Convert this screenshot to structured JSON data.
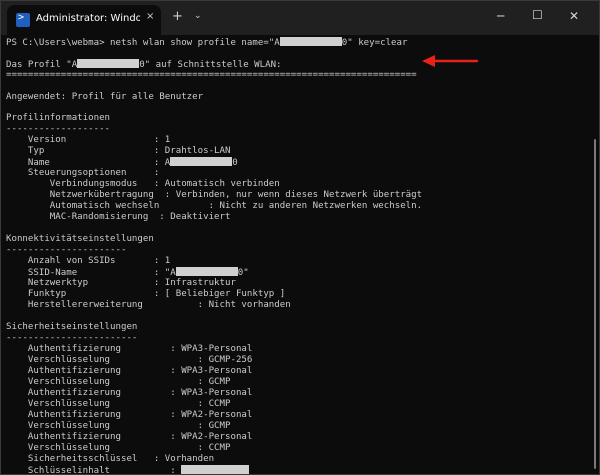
{
  "titlebar": {
    "tab_title": "Administrator: Windows PowerShell",
    "tab_icon": "powershell-icon",
    "tab_close": "×",
    "new_tab": "+",
    "dropdown": "⌄",
    "minimize": "─",
    "maximize": "☐",
    "close": "✕"
  },
  "terminal": {
    "prompt": "PS C:\\Users\\webma> ",
    "command": "netsh wlan show profile name=\"A",
    "command_end": "0\" key=clear",
    "profile_prefix": "Das Profil \"A",
    "profile_suffix": "0\" auf Schnittstelle WLAN:",
    "separator_long": "===========================================================================",
    "applied": "Angewendet: Profil für alle Benutzer",
    "sections": {
      "profile": "Profilinformationen",
      "profile_rule": "-------------------",
      "connectivity": "Konnektivitätseinstellungen",
      "connectivity_rule": "----------------------",
      "security": "Sicherheitseinstellungen",
      "security_rule": "------------------------"
    },
    "profile_info": {
      "version": "    Version                : 1",
      "type": "    Typ                    : Drahtlos-LAN",
      "name_prefix": "    Name                   : A",
      "name_suffix": "0",
      "control": "    Steuerungsoptionen     :",
      "conn_mode": "        Verbindungsmodus   : Automatisch verbinden",
      "network_transfer": "        Netzwerkübertragung  : Verbinden, nur wenn dieses Netzwerk überträgt",
      "auto_switch": "        Automatisch wechseln         : Nicht zu anderen Netzwerken wechseln.",
      "mac_random": "        MAC-Randomisierung  : Deaktiviert"
    },
    "connectivity": {
      "ssid_count": "    Anzahl von SSIDs       : 1",
      "ssid_name_prefix": "    SSID-Name              : \"A",
      "ssid_name_suffix": "0\"",
      "network_type": "    Netzwerktyp            : Infrastruktur",
      "radio_type": "    Funktyp                : [ Beliebiger Funktyp ]",
      "vendor_ext": "    Herstellererweiterung          : Nicht vorhanden"
    },
    "security": [
      "    Authentifizierung         : WPA3-Personal",
      "    Verschlüsselung                : GCMP-256",
      "    Authentifizierung         : WPA3-Personal",
      "    Verschlüsselung                : GCMP",
      "    Authentifizierung         : WPA3-Personal",
      "    Verschlüsselung                : CCMP",
      "    Authentifizierung         : WPA2-Personal",
      "    Verschlüsselung                : GCMP",
      "    Authentifizierung         : WPA2-Personal",
      "    Verschlüsselung                : CCMP"
    ],
    "security_key": "    Sicherheitsschlüssel   : Vorhanden",
    "key_content": "    Schlüsselinhalt           : "
  },
  "colors": {
    "background": "#0c0c0c",
    "text": "#cccccc",
    "arrow": "#e8211b",
    "redaction": "#d0d0d0"
  }
}
